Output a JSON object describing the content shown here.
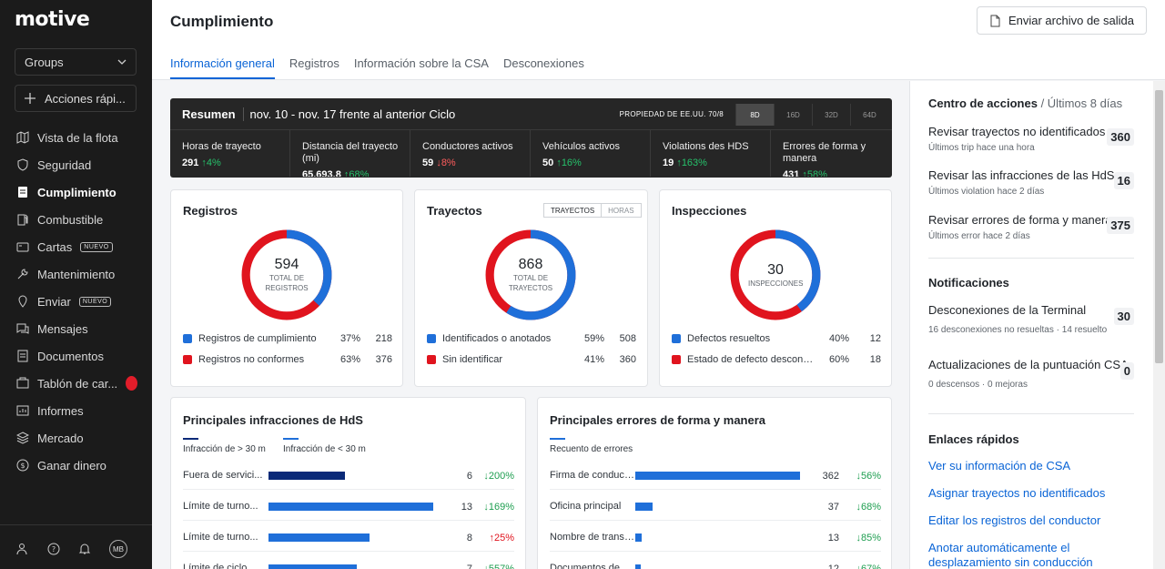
{
  "sidebar": {
    "logo": "motive",
    "groups_label": "Groups",
    "quick_actions_label": "Acciones rápi...",
    "items": [
      {
        "label": "Vista de la flota",
        "icon": "map-icon",
        "active": false,
        "badge": ""
      },
      {
        "label": "Seguridad",
        "icon": "shield-icon",
        "active": false,
        "badge": ""
      },
      {
        "label": "Cumplimiento",
        "icon": "document-icon",
        "active": true,
        "badge": ""
      },
      {
        "label": "Combustible",
        "icon": "fuel-icon",
        "active": false,
        "badge": ""
      },
      {
        "label": "Cartas",
        "icon": "card-icon",
        "active": false,
        "badge": "NUEVO"
      },
      {
        "label": "Mantenimiento",
        "icon": "wrench-icon",
        "active": false,
        "badge": ""
      },
      {
        "label": "Enviar",
        "icon": "dispatch-icon",
        "active": false,
        "badge": "NUEVO"
      },
      {
        "label": "Mensajes",
        "icon": "chat-icon",
        "active": false,
        "badge": ""
      },
      {
        "label": "Documentos",
        "icon": "file-icon",
        "active": false,
        "badge": ""
      },
      {
        "label": "Tablón de car...",
        "icon": "board-icon",
        "active": false,
        "badge": ""
      },
      {
        "label": "Informes",
        "icon": "report-icon",
        "active": false,
        "badge": ""
      },
      {
        "label": "Mercado",
        "icon": "market-icon",
        "active": false,
        "badge": ""
      },
      {
        "label": "Ganar dinero",
        "icon": "dollar-icon",
        "active": false,
        "badge": ""
      }
    ],
    "avatar_initials": "MB"
  },
  "header": {
    "title": "Cumplimiento",
    "send_button": "Enviar archivo de salida",
    "tabs": [
      "Información general",
      "Registros",
      "Información sobre la CSA",
      "Desconexiones"
    ]
  },
  "summary": {
    "title": "Resumen",
    "range": "nov. 10 - nov. 17 frente al anterior Ciclo",
    "property": "PROPIEDAD DE EE.UU. 70/8",
    "periods": [
      "8D",
      "16D",
      "32D",
      "64D"
    ],
    "metrics": [
      {
        "label": "Horas de trayecto",
        "value": "291",
        "change": "↑4%",
        "dir": "up"
      },
      {
        "label": "Distancia del trayecto (mi)",
        "value": "65,693.8",
        "change": "↑68%",
        "dir": "up"
      },
      {
        "label": "Conductores activos",
        "value": "59",
        "change": "↓8%",
        "dir": "down"
      },
      {
        "label": "Vehículos activos",
        "value": "50",
        "change": "↑16%",
        "dir": "up"
      },
      {
        "label": "Violations des HDS",
        "value": "19",
        "change": "↑163%",
        "dir": "up"
      },
      {
        "label": "Errores de forma y manera",
        "value": "431",
        "change": "↑58%",
        "dir": "up"
      }
    ]
  },
  "cards": {
    "registros": {
      "title": "Registros",
      "total": "594",
      "total_label": "TOTAL DE REGISTROS",
      "legend": [
        {
          "label": "Registros de cumplimiento",
          "pct": "37%",
          "count": "218",
          "color": "#1f6fd9"
        },
        {
          "label": "Registros no conformes",
          "pct": "63%",
          "count": "376",
          "color": "#e0141e"
        }
      ]
    },
    "trayectos": {
      "title": "Trayectos",
      "toggle": [
        "TRAYECTOS",
        "HORAS"
      ],
      "total": "868",
      "total_label": "TOTAL DE TRAYECTOS",
      "legend": [
        {
          "label": "Identificados o anotados",
          "pct": "59%",
          "count": "508",
          "color": "#1f6fd9"
        },
        {
          "label": "Sin identificar",
          "pct": "41%",
          "count": "360",
          "color": "#e0141e"
        }
      ]
    },
    "inspecciones": {
      "title": "Inspecciones",
      "total": "30",
      "total_label": "INSPECCIONES",
      "legend": [
        {
          "label": "Defectos resueltos",
          "pct": "40%",
          "count": "12",
          "color": "#1f6fd9"
        },
        {
          "label": "Estado de defecto desconoci...",
          "pct": "60%",
          "count": "18",
          "color": "#e0141e"
        }
      ]
    },
    "hos": {
      "title": "Principales infracciones de HdS",
      "legend": [
        "Infracción de > 30 m",
        "Infracción de < 30 m"
      ],
      "rows": [
        {
          "label": "Fuera de servici...",
          "value": 6,
          "change": "↓200%",
          "dir": "up",
          "color": "#0a2a78"
        },
        {
          "label": "Límite de turno...",
          "value": 13,
          "change": "↓169%",
          "dir": "up",
          "color": "#1f6fd9"
        },
        {
          "label": "Límite de turno...",
          "value": 8,
          "change": "↑25%",
          "dir": "down",
          "color": "#1f6fd9"
        },
        {
          "label": "Límite de ciclo...",
          "value": 7,
          "change": "↓557%",
          "dir": "up",
          "color": "#1f6fd9"
        }
      ]
    },
    "form": {
      "title": "Principales errores de forma y manera",
      "legend": "Recuento de errores",
      "rows": [
        {
          "label": "Firma de conductor",
          "value": 362,
          "change": "↓56%",
          "dir": "up"
        },
        {
          "label": "Oficina principal",
          "value": 37,
          "change": "↓68%",
          "dir": "up"
        },
        {
          "label": "Nombre de transp...",
          "value": 13,
          "change": "↓85%",
          "dir": "up"
        },
        {
          "label": "Documentos de ...",
          "value": 12,
          "change": "↓67%",
          "dir": "up"
        }
      ]
    }
  },
  "right_panel": {
    "actions_title": "Centro de acciones",
    "actions_period": "/ Últimos 8 días",
    "actions": [
      {
        "title": "Revisar trayectos no identificados",
        "sub": "Últimos trip hace una hora",
        "count": "360"
      },
      {
        "title": "Revisar las infracciones de las HdS",
        "sub": "Últimos violation hace 2 días",
        "count": "16"
      },
      {
        "title": "Revisar errores de forma y manera",
        "sub": "Últimos error hace 2 días",
        "count": "375"
      }
    ],
    "notifications_title": "Notificaciones",
    "notifications": [
      {
        "title": "Desconexiones de la Terminal",
        "sub": "16 desconexiones no resueltas · 14 resuelto",
        "count": "30"
      },
      {
        "title": "Actualizaciones de la puntuación CSA",
        "sub": "0 descensos · 0 mejoras",
        "count": "0"
      }
    ],
    "links_title": "Enlaces rápidos",
    "links": [
      "Ver su información de CSA",
      "Asignar trayectos no identificados",
      "Editar los registros del conductor",
      "Anotar automáticamente el desplazamiento sin conducción"
    ]
  }
}
